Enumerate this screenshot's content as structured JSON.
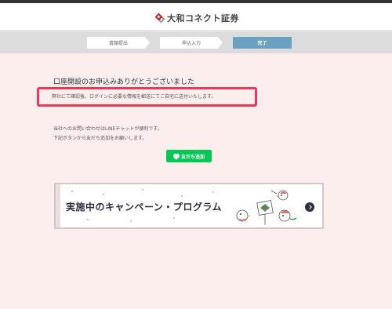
{
  "header": {
    "logo_text": "大和コネクト証券"
  },
  "steps": [
    {
      "label": "書類提出",
      "state": "done"
    },
    {
      "label": "申込入力",
      "state": "done"
    },
    {
      "label": "完了",
      "state": "current"
    }
  ],
  "main": {
    "heading": "口座開設のお申込みありがとうございました",
    "notice": "弊社にて確認後、ログインに必要な情報を郵送にてご自宅に送付いたします。",
    "line_info": [
      "当社へのお問い合わせはLINEチャットが便利です。",
      "下記ボタンから友だち追加をお願いします。"
    ],
    "line_button_label": "友だち追加"
  },
  "banner": {
    "title": "実施中のキャンペーン・プログラム"
  },
  "colors": {
    "background": "#fdeeee",
    "step_active": "#6aa1c0",
    "notice_border": "#e83a5a",
    "line_green": "#06c755",
    "brand_red": "#cc2233"
  },
  "icons": [
    "logo-mark-icon",
    "line-chat-icon",
    "chevron-right-icon"
  ]
}
